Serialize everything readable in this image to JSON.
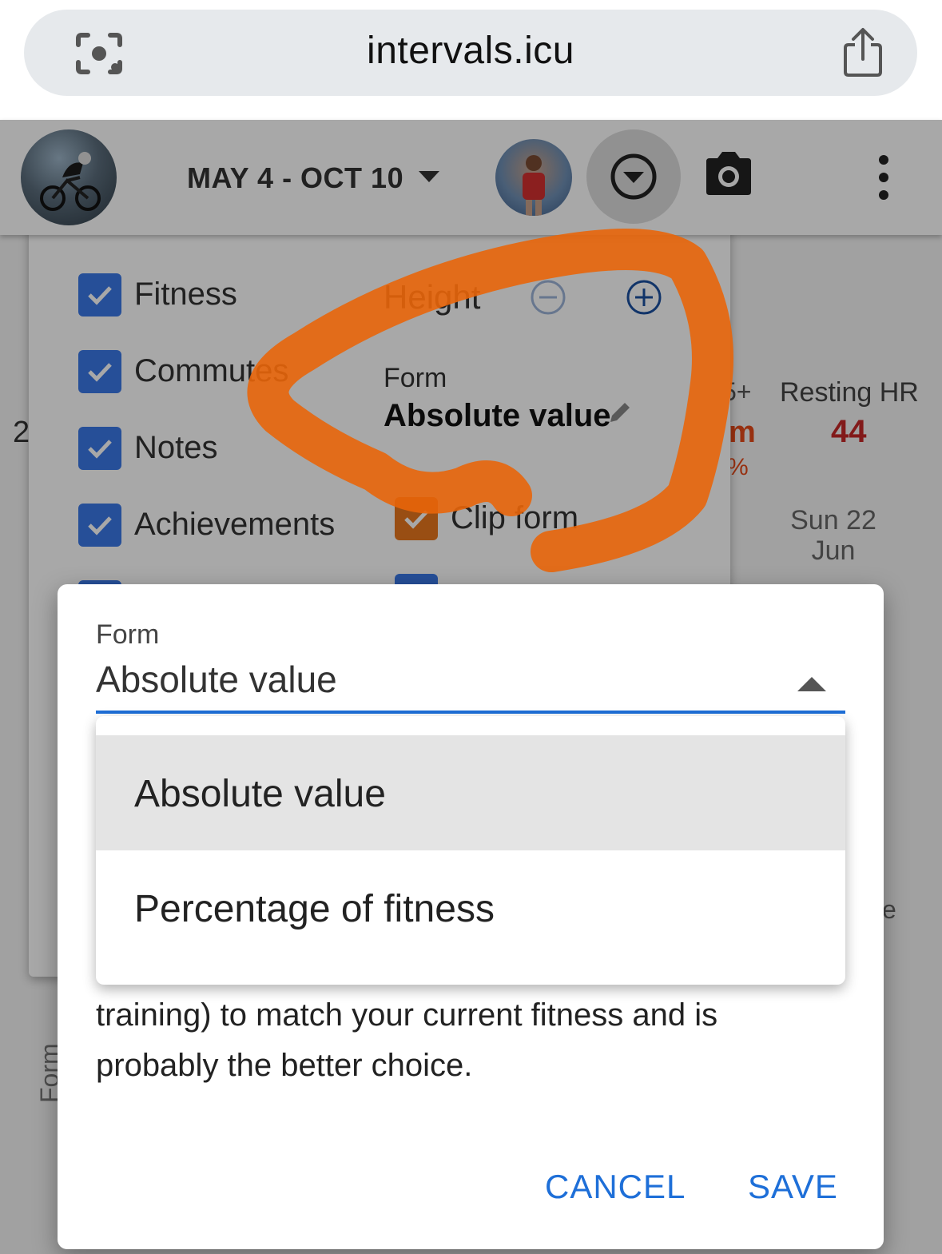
{
  "browser": {
    "url": "intervals.icu",
    "icons": [
      "lens-icon",
      "share-icon"
    ]
  },
  "toolbar": {
    "date_range": "MAY 4 - OCT 10",
    "icons": [
      "chart-options-icon",
      "camera-icon",
      "more-vert-icon"
    ]
  },
  "background": {
    "side_number": "2",
    "peak_label": "5+",
    "peak_value": "m",
    "peak_pct": "%",
    "resting_hr_label": "Resting HR",
    "resting_hr_value": "44",
    "date_label": "Sun 22 Jun",
    "edge_text": "e",
    "axis_label": "Form"
  },
  "panel": {
    "checkboxes": [
      {
        "label": "Fitness",
        "checked": true
      },
      {
        "label": "Commutes",
        "checked": true
      },
      {
        "label": "Notes",
        "checked": true
      },
      {
        "label": "Achievements",
        "checked": true
      }
    ],
    "height_label": "Height",
    "form_label": "Form",
    "form_value": "Absolute value",
    "clip_form_label": "Clip form",
    "clip_form_checked": true
  },
  "dialog": {
    "field_label": "Form",
    "field_value": "Absolute value",
    "options": [
      "Absolute value",
      "Percentage of fitness"
    ],
    "selected_option": "Absolute value",
    "help_text": "training) to match your current fitness and is probably the better choice.",
    "cancel_label": "CANCEL",
    "save_label": "SAVE"
  },
  "colors": {
    "accent": "#1e6fd8",
    "checkbox": "#3b78e7",
    "annotation": "#e8650a",
    "hr_value": "#c62828"
  }
}
